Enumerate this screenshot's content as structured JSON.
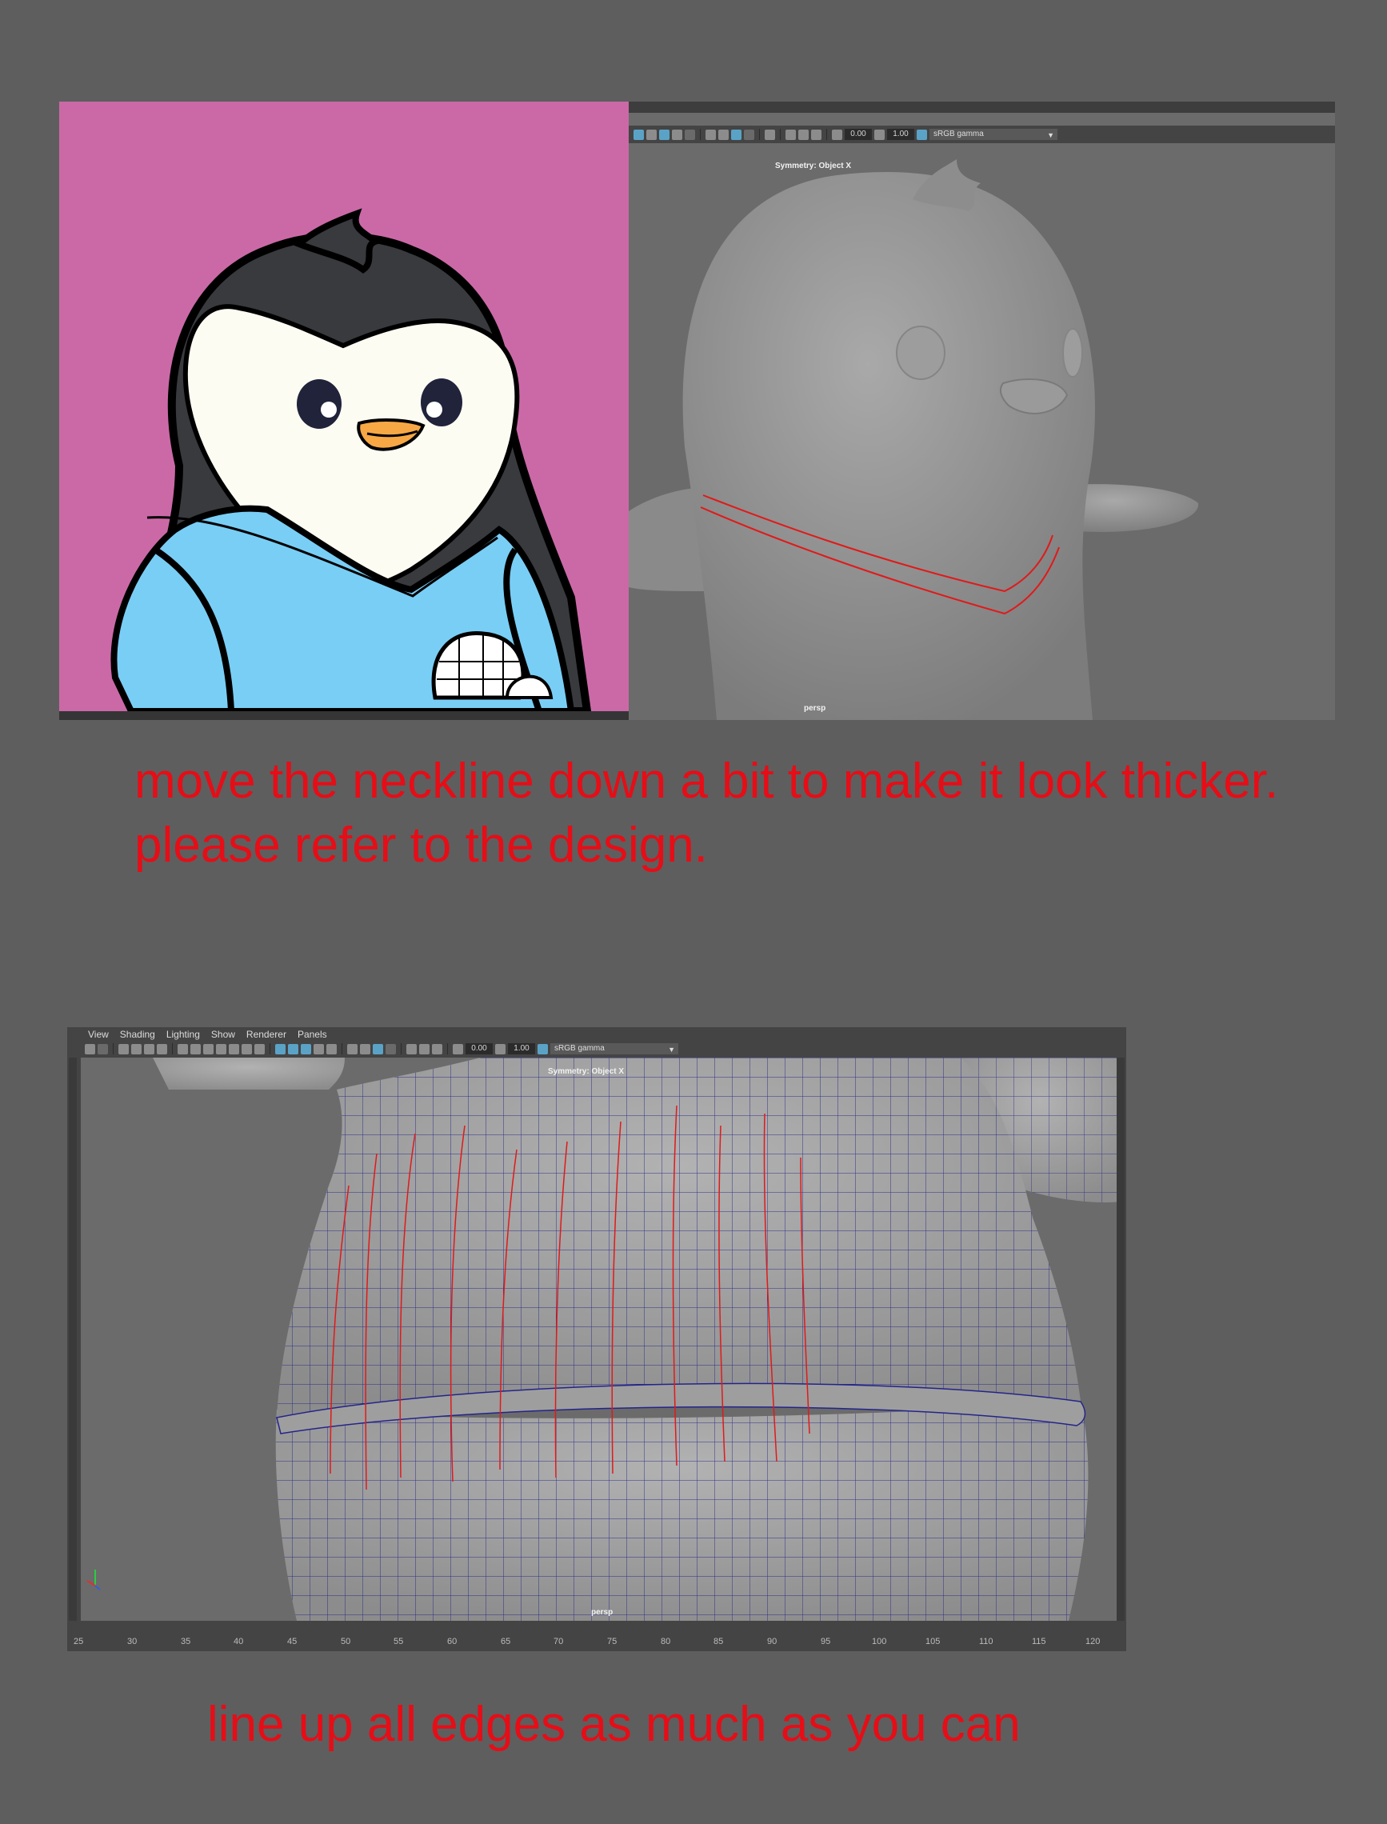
{
  "top_note_line1": "move the neckline down a bit to make it look thicker.",
  "top_note_line2": "please refer to the design.",
  "bottom_note": "line up all edges as much as you can",
  "viewport_top": {
    "symmetry_label": "Symmetry: Object X",
    "camera_label": "persp",
    "exposure_value": "0.00",
    "gamma_value": "1.00",
    "color_space": "sRGB gamma"
  },
  "viewport_bottom": {
    "menus": [
      "View",
      "Shading",
      "Lighting",
      "Show",
      "Renderer",
      "Panels"
    ],
    "symmetry_label": "Symmetry: Object X",
    "camera_label": "persp",
    "exposure_value": "0.00",
    "gamma_value": "1.00",
    "color_space": "sRGB gamma",
    "timeline_ticks": [
      "25",
      "30",
      "35",
      "40",
      "45",
      "50",
      "55",
      "60",
      "65",
      "70",
      "75",
      "80",
      "85",
      "90",
      "95",
      "100",
      "105",
      "110",
      "115",
      "120"
    ]
  },
  "colors": {
    "annotation": "#e60d17",
    "design_background": "#cb69a7",
    "shirt": "#79cef5",
    "beak": "#f7a845",
    "wireframe": "#1d1d8a",
    "page_background": "#5e5e5e"
  }
}
